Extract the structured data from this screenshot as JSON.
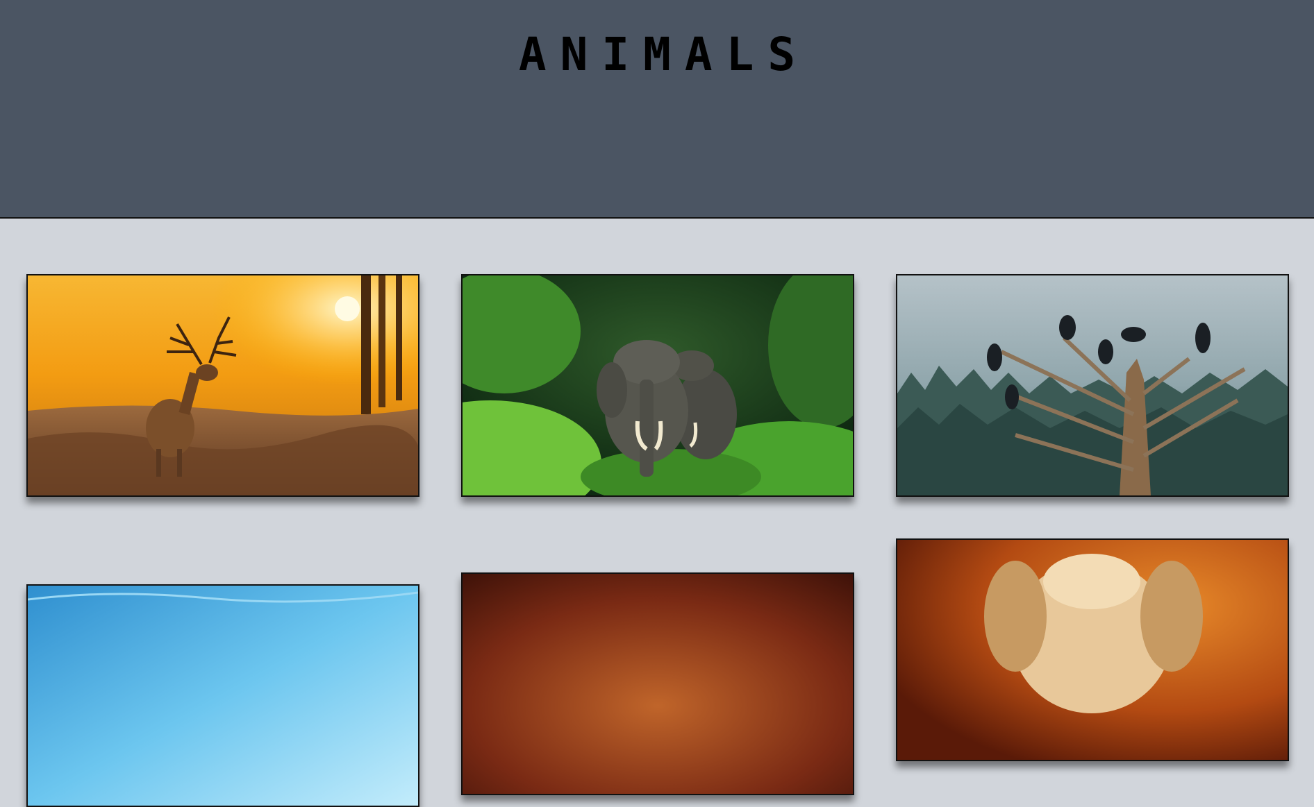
{
  "header": {
    "title": "ANIMALS",
    "background": "#4b5563"
  },
  "gallery": {
    "background": "#d1d5db",
    "items": [
      {
        "icon": "deer-photo-icon"
      },
      {
        "icon": "elephant-photo-icon"
      },
      {
        "icon": "crows-photo-icon"
      },
      {
        "icon": "ice-photo-icon"
      },
      {
        "icon": "sunset-photo-icon"
      },
      {
        "icon": "dog-photo-icon"
      }
    ]
  }
}
